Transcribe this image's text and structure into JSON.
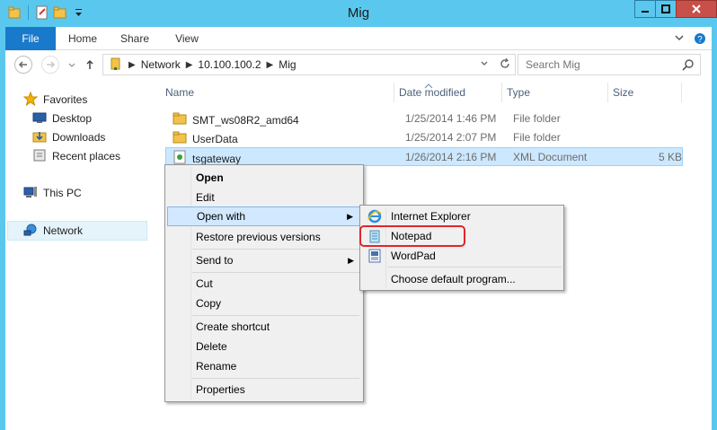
{
  "window": {
    "title": "Mig"
  },
  "ribbon": {
    "tabs": [
      "File",
      "Home",
      "Share",
      "View"
    ]
  },
  "address": {
    "crumbs": [
      "Network",
      "10.100.100.2",
      "Mig"
    ]
  },
  "search": {
    "placeholder": "Search Mig"
  },
  "sidebar": {
    "items": [
      {
        "label": "Favorites",
        "icon": "star-icon"
      },
      {
        "label": "Desktop",
        "icon": "desktop-icon"
      },
      {
        "label": "Downloads",
        "icon": "downloads-icon"
      },
      {
        "label": "Recent places",
        "icon": "recent-places-icon"
      },
      {
        "label": "This PC",
        "icon": "computer-icon"
      },
      {
        "label": "Network",
        "icon": "network-icon"
      }
    ]
  },
  "columns": {
    "name": "Name",
    "date": "Date modified",
    "type": "Type",
    "size": "Size"
  },
  "files": [
    {
      "name": "SMT_ws08R2_amd64",
      "date": "1/25/2014 1:46 PM",
      "type": "File folder",
      "size": "",
      "icon": "folder-icon"
    },
    {
      "name": "UserData",
      "date": "1/25/2014 2:07 PM",
      "type": "File folder",
      "size": "",
      "icon": "folder-icon"
    },
    {
      "name": "tsgateway",
      "date": "1/26/2014 2:16 PM",
      "type": "XML Document",
      "size": "5 KB",
      "icon": "xml-file-icon"
    }
  ],
  "context_menu": {
    "items": [
      "Open",
      "Edit",
      "Open with",
      "Restore previous versions",
      "Send to",
      "Cut",
      "Copy",
      "Create shortcut",
      "Delete",
      "Rename",
      "Properties"
    ]
  },
  "open_with_menu": {
    "items": [
      "Internet Explorer",
      "Notepad",
      "WordPad",
      "Choose default program..."
    ]
  },
  "colors": {
    "titlebar": "#5ac8ee",
    "file_tab": "#1979ca",
    "close_button": "#c7504a",
    "selection": "#cce8ff",
    "highlight_ring": "#e0262b"
  }
}
